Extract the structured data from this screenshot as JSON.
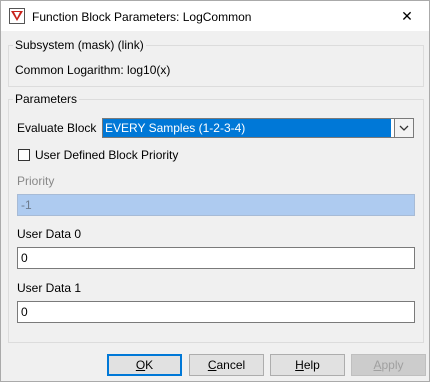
{
  "window": {
    "title": "Function Block Parameters: LogCommon",
    "close_glyph": "✕"
  },
  "subsystem": {
    "heading": "Subsystem (mask) (link)",
    "description": "Common Logarithm: log10(x)"
  },
  "parameters": {
    "heading": "Parameters",
    "evaluate_block_label": "Evaluate Block",
    "evaluate_block_value": "EVERY Samples (1-2-3-4)",
    "user_priority_label": "User Defined Block Priority",
    "user_priority_checked": false,
    "priority_label": "Priority",
    "priority_value": "-1",
    "user_data_0_label": "User Data 0",
    "user_data_0_value": "0",
    "user_data_1_label": "User Data 1",
    "user_data_1_value": "0"
  },
  "buttons": {
    "ok_mnemonic": "O",
    "ok_rest": "K",
    "cancel_mnemonic": "C",
    "cancel_rest": "ancel",
    "help_mnemonic": "H",
    "help_rest": "elp",
    "apply_mnemonic": "A",
    "apply_rest": "pply"
  },
  "colors": {
    "selection": "#0078d7",
    "disabled_field": "#aecbf0"
  }
}
